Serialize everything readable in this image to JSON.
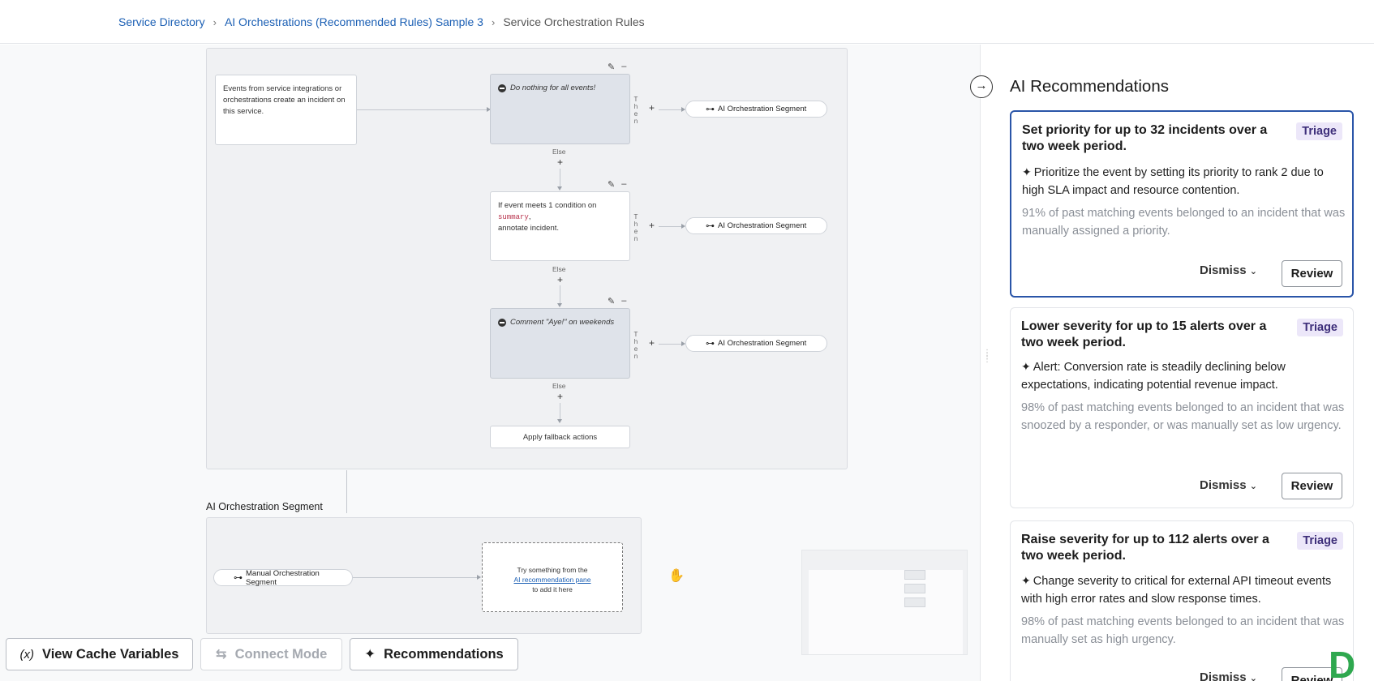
{
  "breadcrumb": {
    "items": [
      "Service Directory",
      "AI Orchestrations (Recommended Rules) Sample 3"
    ],
    "current": "Service Orchestration Rules",
    "separator": "›"
  },
  "canvas": {
    "start_node_text": "Events from service integrations or orchestrations create an incident on this service.",
    "rules": [
      {
        "title": "Do nothing for all events!"
      },
      {
        "line1": "If event meets 1 condition on",
        "code": "summary",
        "code_suffix": ",",
        "line2": "annotate incident."
      },
      {
        "title": "Comment \"Aye!\" on weekends"
      }
    ],
    "then_label": "Then",
    "else_label": "Else",
    "segment_pill_label": "AI Orchestration Segment",
    "fallback_label": "Apply fallback actions",
    "segment_section_label": "AI Orchestration Segment",
    "manual_segment_label": "Manual Orchestration Segment",
    "drop_zone": {
      "line1": "Try something from the",
      "link": "AI recommendation pane",
      "line2": "to add it here"
    }
  },
  "toolbar": {
    "cache_label": "View Cache Variables",
    "cache_icon": "(x)",
    "connect_label": "Connect Mode",
    "recommendations_label": "Recommendations"
  },
  "panel": {
    "title": "AI Recommendations",
    "dismiss_label": "Dismiss",
    "review_label": "Review",
    "cards": [
      {
        "title": "Set priority for up to 32 incidents over a two week period.",
        "badge": "Triage",
        "description": "Prioritize the event by setting its priority to rank 2 due to high SLA impact and resource contention.",
        "stat": "91% of past matching events belonged to an incident that was manually assigned a priority."
      },
      {
        "title": "Lower severity for up to 15 alerts over a two week period.",
        "badge": "Triage",
        "description": "Alert: Conversion rate is steadily declining below expectations, indicating potential revenue impact.",
        "stat": "98% of past matching events belonged to an incident that was snoozed by a responder, or was manually set as low urgency."
      },
      {
        "title": "Raise severity for up to 112 alerts over a two week period.",
        "badge": "Triage",
        "description": "Change severity to critical for external API timeout events with high error rates and slow response times.",
        "stat": "98% of past matching events belonged to an incident that was manually set as high urgency."
      }
    ]
  },
  "colors": {
    "accent_link": "#1b5fb4",
    "selected_border": "#2a55a8",
    "badge_bg": "#ece7f9",
    "badge_text": "#3e2f7a",
    "code": "#b8324c"
  },
  "icons": [
    "arrow-right-icon",
    "sparkle-icon",
    "chevron-down-icon",
    "pencil-icon",
    "minus-icon",
    "plus-icon",
    "segment-icon",
    "hand-cursor-icon",
    "connect-icon",
    "variable-icon"
  ]
}
